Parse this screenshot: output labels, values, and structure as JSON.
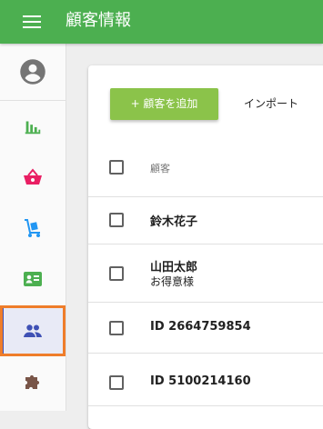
{
  "app": {
    "title": "顧客情報",
    "accent_color": "#4caf50",
    "menu_icon": "hamburger-menu-icon"
  },
  "sidebar": {
    "items": [
      {
        "name": "account",
        "icon": "account-circle-icon",
        "color": "#757575",
        "selected": false
      },
      {
        "name": "reports",
        "icon": "bar-chart-icon",
        "color": "#4caf50",
        "selected": false
      },
      {
        "name": "orders",
        "icon": "shopping-basket-icon",
        "color": "#e91e63",
        "selected": false
      },
      {
        "name": "products",
        "icon": "hand-truck-icon",
        "color": "#2196f3",
        "selected": false
      },
      {
        "name": "contacts",
        "icon": "contact-card-icon",
        "color": "#4caf50",
        "selected": false
      },
      {
        "name": "customers",
        "icon": "people-icon",
        "color": "#3f51b5",
        "selected": true
      },
      {
        "name": "extensions",
        "icon": "puzzle-icon",
        "color": "#795548",
        "selected": false
      }
    ]
  },
  "toolbar": {
    "add_label": "+ 顧客を追加",
    "import_label": "インポート"
  },
  "table": {
    "header": "顧客",
    "rows": [
      {
        "name": "鈴木花子",
        "sub": ""
      },
      {
        "name": "山田太郎",
        "sub": "お得意様"
      },
      {
        "name": "ID 2664759854",
        "sub": ""
      },
      {
        "name": "ID 5100214160",
        "sub": ""
      }
    ]
  }
}
